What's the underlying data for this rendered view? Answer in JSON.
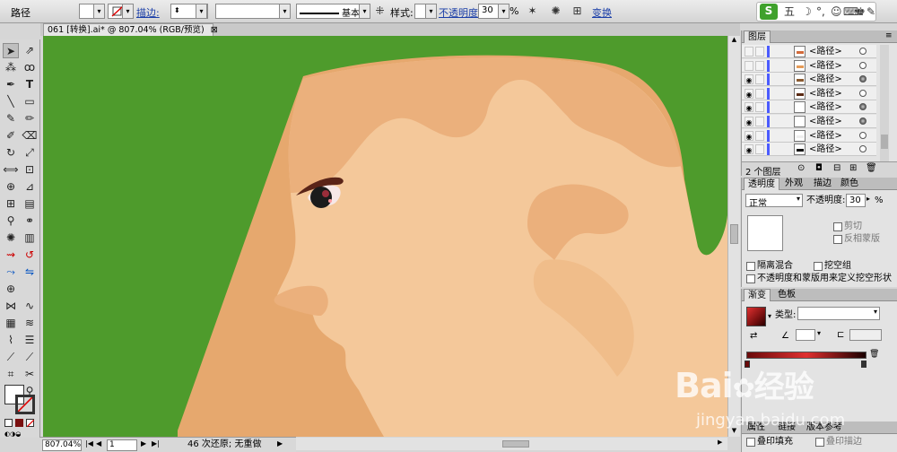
{
  "control_bar": {
    "object_type": "路径",
    "stroke_link": "描边:",
    "stroke_profile": "基本",
    "style_label": "样式:",
    "opacity_link": "不透明度",
    "opacity_value": "30",
    "opacity_unit": "%",
    "transform_link": "变换"
  },
  "ime_toolbar": {
    "logo": "S",
    "mode": "五",
    "icons": [
      "moon-icon",
      "punctuation-icon",
      "emoji-icon",
      "keyboard-icon",
      "skin-icon",
      "wrench-icon"
    ]
  },
  "document_tab": {
    "title": "061 [转换].ai* @ 807.04% (RGB/预览)",
    "close": "⊠"
  },
  "status_bar": {
    "zoom": "807.04%",
    "page": "1",
    "status_text": "46 次还原; 无重做"
  },
  "layers_panel": {
    "title": "图层",
    "rows": [
      {
        "name": "<路径>",
        "visible": false,
        "target_filled": false,
        "thumb_color": "#d26a3a"
      },
      {
        "name": "<路径>",
        "visible": false,
        "target_filled": false,
        "thumb_color": "#e59b57"
      },
      {
        "name": "<路径>",
        "visible": true,
        "target_filled": true,
        "thumb_color": "#8a5a30"
      },
      {
        "name": "<路径>",
        "visible": true,
        "target_filled": false,
        "thumb_color": "#5a2a14"
      },
      {
        "name": "<路径>",
        "visible": true,
        "target_filled": true,
        "thumb_color": "#ffffff"
      },
      {
        "name": "<路径>",
        "visible": true,
        "target_filled": true,
        "thumb_color": "#ffffff"
      },
      {
        "name": "<路径>",
        "visible": true,
        "target_filled": false,
        "thumb_color": "#eeeeee"
      },
      {
        "name": "<路径>",
        "visible": true,
        "target_filled": false,
        "thumb_color": "#111111"
      }
    ],
    "footer_count": "2 个图层"
  },
  "transparency_panel": {
    "tabs": [
      "透明度",
      "外观",
      "描边",
      "颜色"
    ],
    "blend_mode": "正常",
    "opacity_label": "不透明度:",
    "opacity_value": "30",
    "opacity_unit": "%",
    "clip_label": "剪切",
    "invert_mask_label": "反相蒙版",
    "isolate_blending": "隔离混合",
    "knockout_group": "挖空组",
    "opacity_mask_knockout": "不透明度和蒙版用来定义挖空形状"
  },
  "gradient_panel": {
    "tabs": [
      "渐变",
      "色板"
    ],
    "type_label": "类型:",
    "type_value": "",
    "colors": {
      "swatch": "#7a1010",
      "ramp_start": "#6a0a0a",
      "ramp_end": "#e03030"
    }
  },
  "attributes_panel": {
    "tabs": [
      "属性",
      "链接",
      "版本参考"
    ],
    "overprint_fill": "叠印填充",
    "overprint_stroke": "叠印描边"
  },
  "watermark": {
    "brand": "Bai",
    "brand_cn": "经验",
    "url": "jingyan.baidu.com"
  },
  "colors": {
    "canvas_bg": "#4e9b2c",
    "skin_light": "#f4c89a",
    "skin_mid": "#ebb07c",
    "skin_shadow": "#e2a76c"
  }
}
